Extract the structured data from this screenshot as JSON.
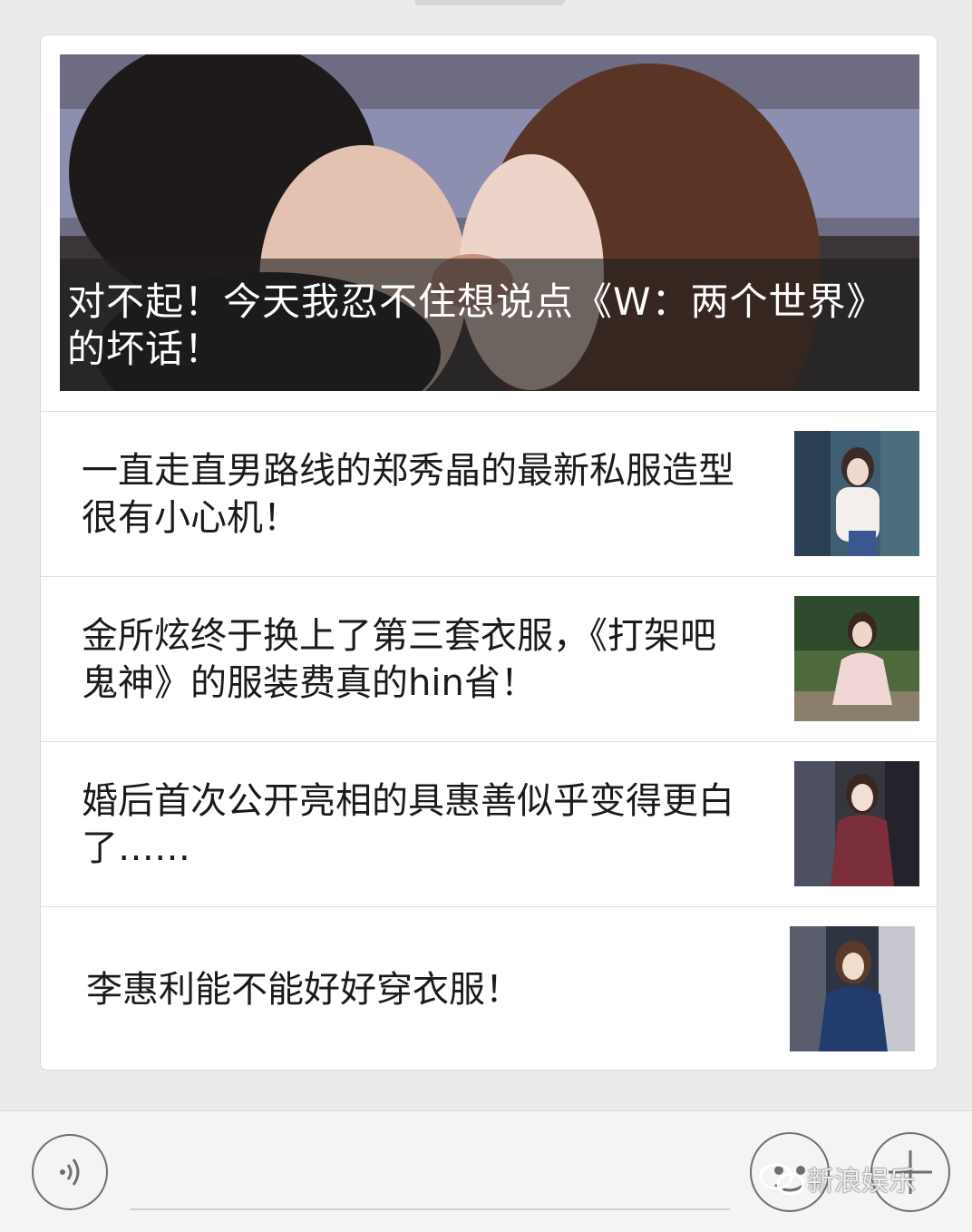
{
  "feed": {
    "hero": {
      "title": "对不起！今天我忍不住想说点《W：两个世界》的坏话！"
    },
    "items": [
      {
        "title": "一直走直男路线的郑秀晶的最新私服造型很有小心机！"
      },
      {
        "title": "金所炫终于换上了第三套衣服，《打架吧鬼神》的服装费真的hin省！"
      },
      {
        "title": "婚后首次公开亮相的具惠善似乎变得更白了……"
      },
      {
        "title": "李惠利能不能好好穿衣服！"
      }
    ]
  },
  "bottom_bar": {
    "voice_icon": "voice-icon",
    "emoji_icon": "emoji-icon",
    "plus_icon": "plus-icon",
    "watermark": "新浪娱乐",
    "colors": {
      "background": "#f4f4f4",
      "icon_stroke": "#6f6f6f"
    }
  }
}
